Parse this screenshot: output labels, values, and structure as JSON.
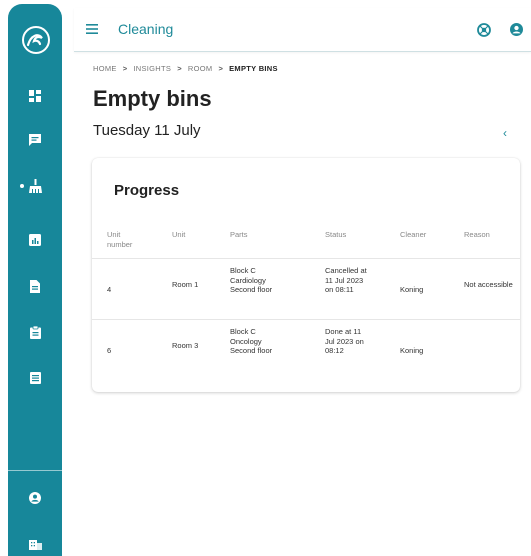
{
  "topbar": {
    "title": "Cleaning"
  },
  "breadcrumb": {
    "items": [
      "HOME",
      "INSIGHTS",
      "ROOM"
    ],
    "current": "EMPTY BINS"
  },
  "page": {
    "title": "Empty bins",
    "date": "Tuesday 11 July"
  },
  "card": {
    "title": "Progress",
    "columns": [
      "Unit number",
      "Unit",
      "Parts",
      "Status",
      "Cleaner",
      "Reason"
    ],
    "rows": [
      {
        "unit_number": "4",
        "unit": "Room 1",
        "parts": "Block C Cardiology Second floor",
        "status": "Cancelled at 11 Jul 2023 on 08:11",
        "cleaner": "Koning",
        "reason": "Not accessible"
      },
      {
        "unit_number": "6",
        "unit": "Room 3",
        "parts": "Block C Oncology Second floor",
        "status": "Done at 11 Jul 2023 on 08:12",
        "cleaner": "Koning",
        "reason": ""
      }
    ]
  },
  "colors": {
    "sidebar": "#17879a",
    "accent": "#1f8a99"
  },
  "icons": {
    "sidebar": [
      "dashboard-icon",
      "chat-icon",
      "broom-icon",
      "insights-icon",
      "document-icon",
      "clipboard-icon",
      "list-icon",
      "account-icon",
      "building-icon"
    ],
    "topbar": [
      "menu-icon",
      "globe-icon",
      "user-icon"
    ]
  }
}
